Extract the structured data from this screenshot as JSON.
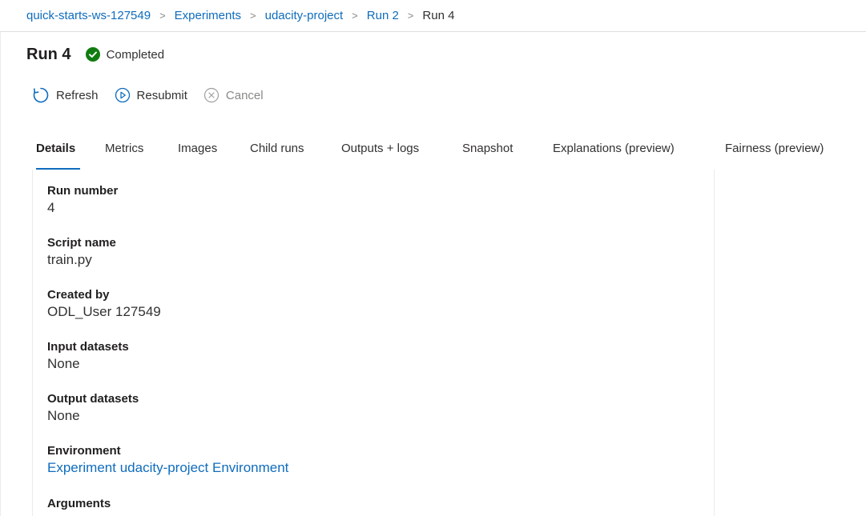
{
  "breadcrumb": {
    "items": [
      "quick-starts-ws-127549",
      "Experiments",
      "udacity-project",
      "Run 2"
    ],
    "current": "Run 4",
    "separator": ">"
  },
  "header": {
    "title": "Run 4",
    "status": "Completed",
    "status_color": "#107c10"
  },
  "toolbar": {
    "refresh_label": "Refresh",
    "resubmit_label": "Resubmit",
    "cancel_label": "Cancel"
  },
  "tabs": [
    {
      "label": "Details",
      "active": true
    },
    {
      "label": "Metrics"
    },
    {
      "label": "Images"
    },
    {
      "label": "Child runs"
    },
    {
      "label": "Outputs + logs"
    },
    {
      "label": "Snapshot"
    },
    {
      "label": "Explanations (preview)"
    },
    {
      "label": "Fairness (preview)"
    }
  ],
  "details": {
    "run_number_label": "Run number",
    "run_number_value": "4",
    "script_name_label": "Script name",
    "script_name_value": "train.py",
    "created_by_label": "Created by",
    "created_by_value": "ODL_User 127549",
    "input_datasets_label": "Input datasets",
    "input_datasets_value": "None",
    "output_datasets_label": "Output datasets",
    "output_datasets_value": "None",
    "environment_label": "Environment",
    "environment_value": "Experiment udacity-project Environment",
    "arguments_label": "Arguments"
  },
  "colors": {
    "accent": "#0f6cbd",
    "success": "#107c10"
  }
}
